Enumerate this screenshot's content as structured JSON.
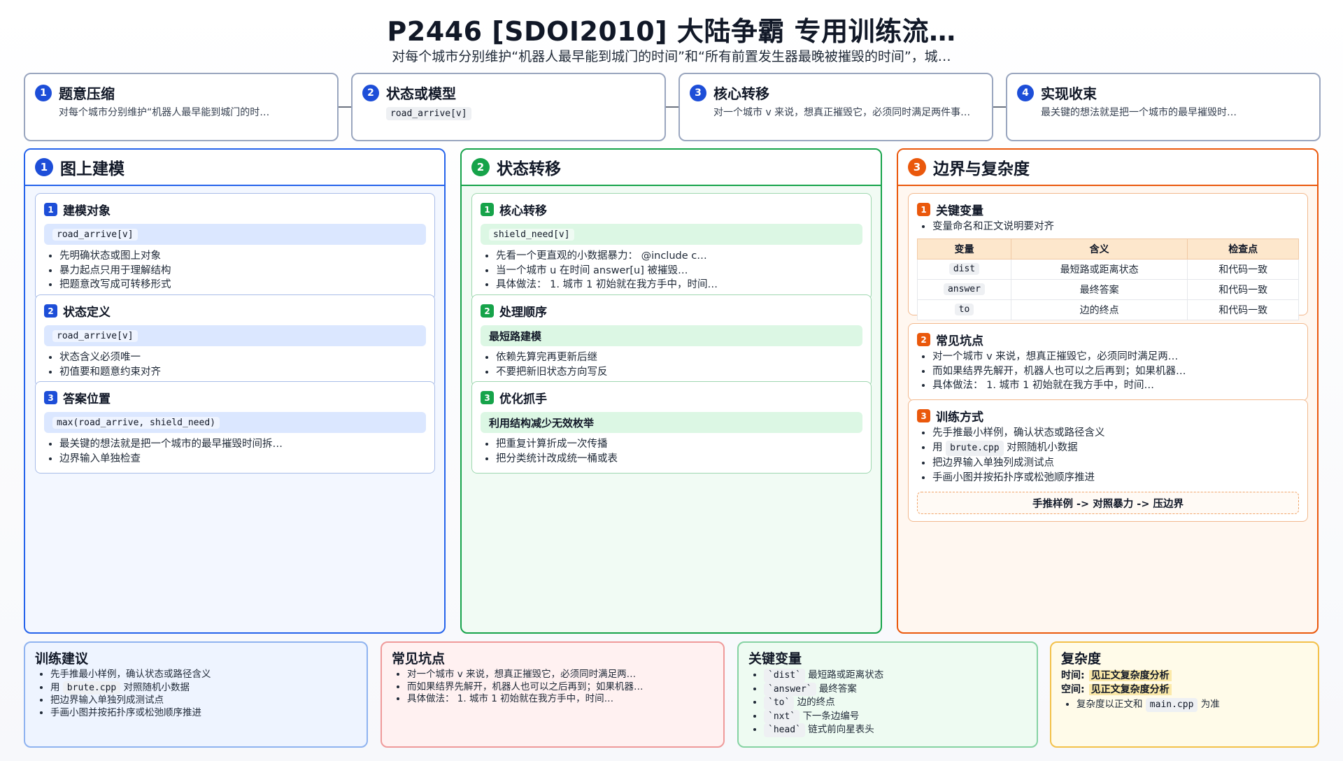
{
  "header": {
    "title": "P2446 [SDOI2010] 大陆争霸 专用训练流…",
    "subtitle": "对每个城市分别维护“机器人最早能到城门的时间”和“所有前置发生器最晚被摧毁的时间”，城…"
  },
  "steps": [
    {
      "num": "1",
      "title": "题意压缩",
      "desc": "对每个城市分别维护“机器人最早能到城门的时…"
    },
    {
      "num": "2",
      "title": "状态或模型",
      "code": "road_arrive[v]"
    },
    {
      "num": "3",
      "title": "核心转移",
      "desc": "对一个城市 v 来说，想真正摧毁它，必须同时满足两件事…"
    },
    {
      "num": "4",
      "title": "实现收束",
      "desc": "最关键的想法就是把一个城市的最早摧毁时…"
    }
  ],
  "columns": {
    "left": {
      "num": "1",
      "title": "图上建模",
      "cards": [
        {
          "num": "1",
          "title": "建模对象",
          "code": "road_arrive[v]",
          "bullets": [
            "先明确状态或图上对象",
            "暴力起点只用于理解结构",
            "把题意改写成可转移形式"
          ]
        },
        {
          "num": "2",
          "title": "状态定义",
          "code": "road_arrive[v]",
          "bullets": [
            "状态含义必须唯一",
            "初值要和题意约束对齐"
          ]
        },
        {
          "num": "3",
          "title": "答案位置",
          "code": "max(road_arrive, shield_need)",
          "bullets": [
            "最关键的想法就是把一个城市的最早摧毁时间拆…",
            "边界输入单独检查"
          ]
        }
      ]
    },
    "middle": {
      "num": "2",
      "title": "状态转移",
      "cards": [
        {
          "num": "1",
          "title": "核心转移",
          "code": "shield_need[v]",
          "bullets": [
            "先看一个更直观的小数据暴力： @include c…",
            "当一个城市 u 在时间 answer[u] 被摧毁…",
            "具体做法： 1. 城市 1 初始就在我方手中，时间…"
          ]
        },
        {
          "num": "2",
          "title": "处理顺序",
          "band": "最短路建模",
          "bullets": [
            "依赖先算完再更新后继",
            "不要把新旧状态方向写反"
          ]
        },
        {
          "num": "3",
          "title": "优化抓手",
          "band": "利用结构减少无效枚举",
          "bullets": [
            "把重复计算折成一次传播",
            "把分类统计改成统一桶或表"
          ]
        }
      ]
    },
    "right": {
      "num": "3",
      "title": "边界与复杂度",
      "vars_card": {
        "num": "1",
        "title": "关键变量",
        "note": "变量命名和正文说明要对齐",
        "headers": [
          "变量",
          "含义",
          "检查点"
        ],
        "rows": [
          [
            "dist",
            "最短路或距离状态",
            "和代码一致"
          ],
          [
            "answer",
            "最终答案",
            "和代码一致"
          ],
          [
            "to",
            "边的终点",
            "和代码一致"
          ]
        ]
      },
      "pitfalls_card": {
        "num": "2",
        "title": "常见坑点",
        "bullets": [
          "对一个城市 v 来说，想真正摧毁它，必须同时满足两…",
          "而如果结界先解开，机器人也可以之后再到；如果机器…",
          "具体做法： 1. 城市 1 初始就在我方手中，时间…"
        ]
      },
      "training_card": {
        "num": "3",
        "title": "训练方式",
        "b1": "先手推最小样例，确认状态或路径含义",
        "b2_pre": "用",
        "b2_code": "brute.cpp",
        "b2_post": "对照随机小数据",
        "b3": "把边界输入单独列成测试点",
        "b4": "手画小图并按拓扑序或松弛顺序推进",
        "flow": "手推样例 -> 对照暴力 -> 压边界"
      }
    }
  },
  "bottom": {
    "advice": {
      "title": "训练建议",
      "b1": "先手推最小样例，确认状态或路径含义",
      "b2_pre": "用",
      "b2_code": "brute.cpp",
      "b2_post": "对照随机小数据",
      "b3": "把边界输入单独列成测试点",
      "b4": "手画小图并按拓扑序或松弛顺序推进"
    },
    "pitfalls": {
      "title": "常见坑点",
      "bullets": [
        "对一个城市 v 来说，想真正摧毁它，必须同时满足两…",
        "而如果结界先解开，机器人也可以之后再到；如果机器…",
        "具体做法： 1. 城市 1 初始就在我方手中，时间…"
      ]
    },
    "variables": {
      "title": "关键变量",
      "items": [
        {
          "code": "`dist`",
          "text": "最短路或距离状态"
        },
        {
          "code": "`answer`",
          "text": "最终答案"
        },
        {
          "code": "`to`",
          "text": "边的终点"
        },
        {
          "code": "`nxt`",
          "text": "下一条边编号"
        },
        {
          "code": "`head`",
          "text": "链式前向星表头"
        }
      ]
    },
    "complexity": {
      "title": "复杂度",
      "time_label": "时间:",
      "time_value": "见正文复杂度分析",
      "space_label": "空间:",
      "space_value": "见正文复杂度分析",
      "note_pre": "复杂度以正文和",
      "note_code": "main.cpp",
      "note_post": "为准"
    }
  },
  "colors": {
    "blue": "#2563eb",
    "green": "#16a34a",
    "orange": "#ea580c",
    "red_border": "#ef9a9a",
    "yellow_border": "#f3c14a"
  }
}
